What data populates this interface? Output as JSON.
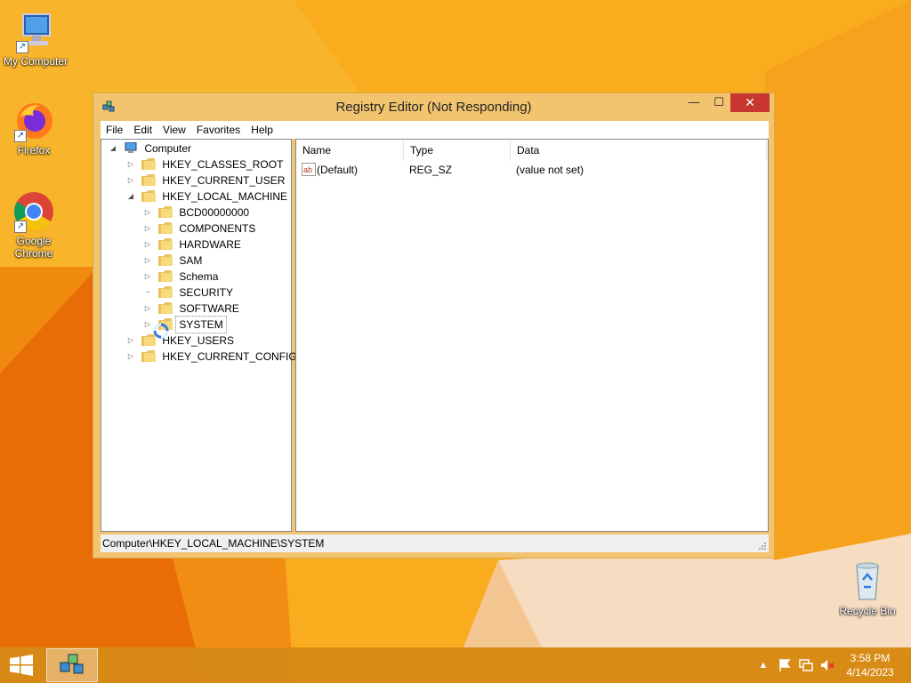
{
  "desktop": {
    "icons": [
      {
        "label": "My Computer"
      },
      {
        "label": "Firefox"
      },
      {
        "label": "Google Chrome"
      },
      {
        "label": "Recycle Bin"
      }
    ]
  },
  "window": {
    "title": "Registry Editor (Not Responding)",
    "controls": {
      "minimize": "—",
      "maximize": "☐",
      "close": "✕"
    },
    "menu": [
      "File",
      "Edit",
      "View",
      "Favorites",
      "Help"
    ],
    "tree": {
      "root": "Computer",
      "hives": [
        "HKEY_CLASSES_ROOT",
        "HKEY_CURRENT_USER",
        "HKEY_LOCAL_MACHINE"
      ],
      "local_machine_children": [
        "BCD00000000",
        "COMPONENTS",
        "HARDWARE",
        "SAM",
        "Schema",
        "SECURITY",
        "SOFTWARE",
        "SYSTEM"
      ],
      "hives_after": [
        "HKEY_USERS",
        "HKEY_CURRENT_CONFIG"
      ],
      "selected": "SYSTEM"
    },
    "list": {
      "columns": [
        "Name",
        "Type",
        "Data"
      ],
      "rows": [
        {
          "name": "(Default)",
          "type": "REG_SZ",
          "data": "(value not set)"
        }
      ]
    },
    "status": "Computer\\HKEY_LOCAL_MACHINE\\SYSTEM"
  },
  "taskbar": {
    "clock_time": "3:58 PM",
    "clock_date": "4/14/2023"
  },
  "colors": {
    "accent": "#f3c46f",
    "wallpaper": "#f7a81f",
    "close_button": "#c7372f"
  }
}
